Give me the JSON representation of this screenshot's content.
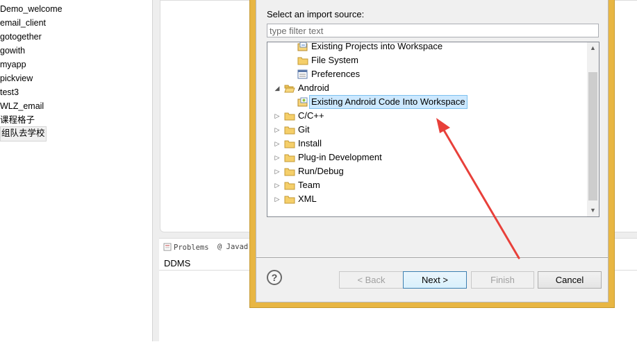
{
  "explorer": {
    "items": [
      "Demo_welcome",
      "email_client",
      "gotogether",
      "gowith",
      "myapp",
      "pickview",
      "test3",
      "WLZ_email",
      "课程格子",
      "组队去学校"
    ]
  },
  "bottom_panel": {
    "tabs": [
      {
        "label": "Problems",
        "icon": "problems-icon"
      },
      {
        "label": "@ Javad",
        "icon": "javadoc-icon"
      }
    ],
    "view_label": "DDMS"
  },
  "dialog": {
    "source_label": "Select an import source:",
    "filter_placeholder": "type filter text",
    "tree": [
      {
        "label": "Existing Projects into Workspace",
        "level": 1,
        "icon": "projects-import-icon"
      },
      {
        "label": "File System",
        "level": 1,
        "icon": "folder-icon"
      },
      {
        "label": "Preferences",
        "level": 1,
        "icon": "preferences-icon"
      },
      {
        "label": "Android",
        "level": 0,
        "expanded": true,
        "icon": "folder-open-icon"
      },
      {
        "label": "Existing Android Code Into Workspace",
        "level": 1,
        "icon": "android-import-icon",
        "selected": true
      },
      {
        "label": "C/C++",
        "level": 0,
        "expanded": false,
        "icon": "folder-icon"
      },
      {
        "label": "Git",
        "level": 0,
        "expanded": false,
        "icon": "folder-icon"
      },
      {
        "label": "Install",
        "level": 0,
        "expanded": false,
        "icon": "folder-icon"
      },
      {
        "label": "Plug-in Development",
        "level": 0,
        "expanded": false,
        "icon": "folder-icon"
      },
      {
        "label": "Run/Debug",
        "level": 0,
        "expanded": false,
        "icon": "folder-icon"
      },
      {
        "label": "Team",
        "level": 0,
        "expanded": false,
        "icon": "folder-icon"
      },
      {
        "label": "XML",
        "level": 0,
        "expanded": false,
        "icon": "folder-icon"
      }
    ],
    "buttons": {
      "help": "?",
      "back": "< Back",
      "next": "Next >",
      "finish": "Finish",
      "cancel": "Cancel"
    }
  },
  "colors": {
    "dialog_frame": "#e8b643",
    "selection": "#cce8ff",
    "annotation_arrow": "#e8403a"
  }
}
